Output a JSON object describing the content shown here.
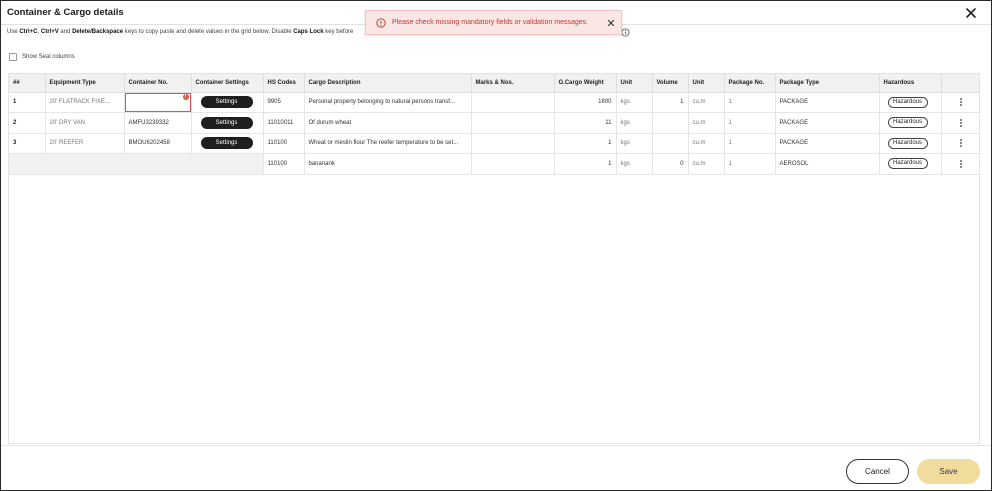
{
  "dialog": {
    "title": "Container & Cargo details",
    "close_icon": "close-icon"
  },
  "instructions": {
    "part1": "Use ",
    "key1": "Ctrl+C",
    "sep1": ", ",
    "key2": "Ctrl+V",
    "part2": " and ",
    "key3": "Delete/Backspace",
    "part3": " keys to copy paste and delete values in the grid below. Disable ",
    "key4": "Caps Lock",
    "part4": " key before"
  },
  "toast": {
    "message": "Please check missing mandatory fields or validation messages.",
    "color": "#c0392b"
  },
  "seal": {
    "label": "Show Seal columns",
    "checked": false
  },
  "grid": {
    "headers": {
      "num": "##",
      "equipment_type": "Equipment Type",
      "container_no": "Container No.",
      "container_settings": "Container Settings",
      "hs_codes": "HS Codes",
      "cargo_description": "Cargo Description",
      "marks": "Marks & Nos.",
      "gross_weight": "G.Cargo Weight",
      "unit_weight": "Unit",
      "volume": "Volume",
      "unit_volume": "Unit",
      "package_no": "Package No.",
      "package_type": "Package Type",
      "hazardous": "Hazardous"
    },
    "settings_label": "Settings",
    "hazardous_label": "Hazardous",
    "rows": [
      {
        "num": "1",
        "equipment_type": "20' FLATRACK FIXE...",
        "container_no": "",
        "hs_code": "9905",
        "description": "Personal property belonging to natural persons transf...",
        "marks": "",
        "weight": "1800",
        "weight_unit": "kgs",
        "volume": "1",
        "volume_unit": "cu.m",
        "package_no": "1",
        "package_type": "PACKAGE"
      },
      {
        "num": "2",
        "equipment_type": "20' DRY VAN",
        "container_no": "AMFU3239332",
        "hs_code": "11010011",
        "description": "Of durum wheat",
        "marks": "",
        "weight": "11",
        "weight_unit": "kgs",
        "volume": "",
        "volume_unit": "cu.m",
        "package_no": "1",
        "package_type": "PACKAGE"
      },
      {
        "num": "3",
        "equipment_type": "20' REEFER",
        "container_no": "BMOU6202458",
        "hs_code": "110100",
        "description": "Wheat or meslin flour The reefer temperature to be set...",
        "marks": "",
        "weight": "1",
        "weight_unit": "kgs",
        "volume": "",
        "volume_unit": "cu.m",
        "package_no": "1",
        "package_type": "PACKAGE"
      },
      {
        "num": "",
        "equipment_type": "",
        "container_no": "",
        "hs_code": "110100",
        "description": "bananank",
        "marks": "",
        "weight": "1",
        "weight_unit": "kgs",
        "volume": "0",
        "volume_unit": "cu.m",
        "package_no": "1",
        "package_type": "AEROSOL"
      }
    ]
  },
  "footer": {
    "cancel_label": "Cancel",
    "save_label": "Save"
  },
  "colors": {
    "save_button": "#f0dc9c",
    "error": "#d9534f",
    "header_bg": "#f1f1f1"
  }
}
